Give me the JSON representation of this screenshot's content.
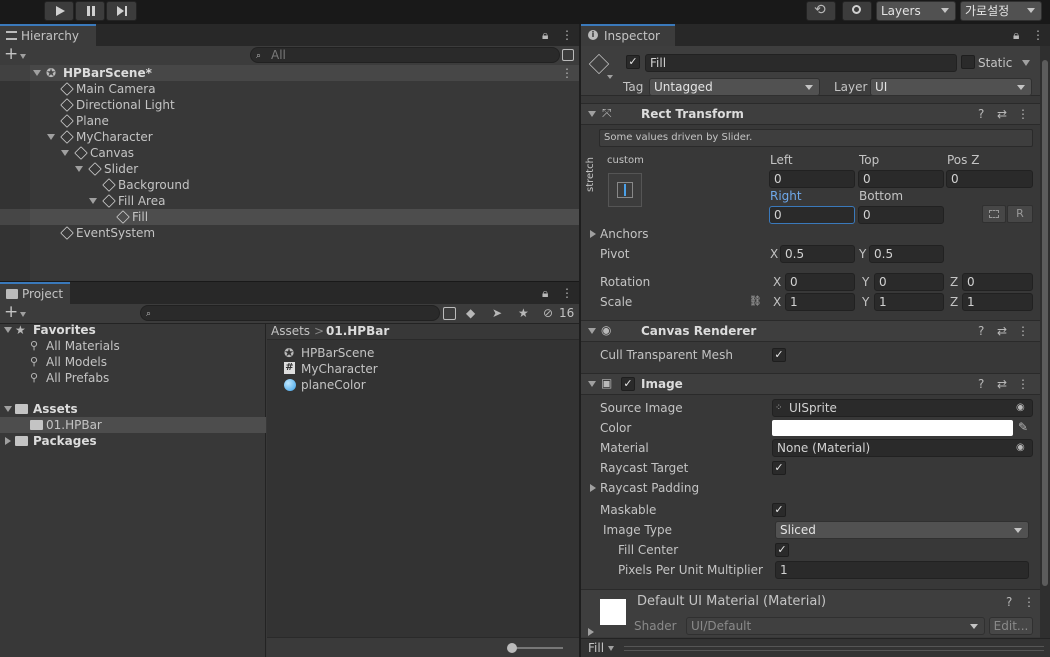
{
  "toolbar": {
    "layers": "Layers",
    "layout": "가로설정"
  },
  "hierarchy": {
    "tab": "Hierarchy",
    "search_placeholder": "All",
    "scene": "HPBarScene*",
    "items": [
      "Main Camera",
      "Directional Light",
      "Plane",
      "MyCharacter",
      "Canvas",
      "Slider",
      "Background",
      "Fill Area",
      "Fill",
      "EventSystem"
    ]
  },
  "project": {
    "tab": "Project",
    "hidden_count": "16",
    "favorites": {
      "label": "Favorites",
      "items": [
        "All Materials",
        "All Models",
        "All Prefabs"
      ]
    },
    "assets": "Assets",
    "assets_child": "01.HPBar",
    "packages": "Packages",
    "breadcrumb": [
      "Assets",
      "01.HPBar"
    ],
    "files": [
      "HPBarScene",
      "MyCharacter",
      "planeColor"
    ]
  },
  "inspector": {
    "tab": "Inspector",
    "object_name": "Fill",
    "static_label": "Static",
    "tag_label": "Tag",
    "tag_value": "Untagged",
    "layer_label": "Layer",
    "layer_value": "UI",
    "rect": {
      "title": "Rect Transform",
      "note": "Some values driven by Slider.",
      "anchor_preset": "custom",
      "stretch": "stretch",
      "left_label": "Left",
      "left": "0",
      "top_label": "Top",
      "top": "0",
      "posz_label": "Pos Z",
      "posz": "0",
      "right_label": "Right",
      "right": "0",
      "bottom_label": "Bottom",
      "bottom": "0",
      "r_button": "R",
      "anchors_label": "Anchors",
      "pivot_label": "Pivot",
      "pivot_x": "0.5",
      "pivot_y": "0.5",
      "rotation_label": "Rotation",
      "rot_x": "0",
      "rot_y": "0",
      "rot_z": "0",
      "scale_label": "Scale",
      "scale_x": "1",
      "scale_y": "1",
      "scale_z": "1",
      "x": "X",
      "y": "Y",
      "z": "Z"
    },
    "canvas_renderer": {
      "title": "Canvas Renderer",
      "cull_label": "Cull Transparent Mesh"
    },
    "image": {
      "title": "Image",
      "source_label": "Source Image",
      "source_value": "UISprite",
      "color_label": "Color",
      "color_value": "#ffffff",
      "material_label": "Material",
      "material_value": "None (Material)",
      "raycast_target_label": "Raycast Target",
      "raycast_padding_label": "Raycast Padding",
      "maskable_label": "Maskable",
      "image_type_label": "Image Type",
      "image_type_value": "Sliced",
      "fill_center_label": "Fill Center",
      "ppu_label": "Pixels Per Unit Multiplier",
      "ppu_value": "1"
    },
    "material": {
      "title": "Default UI Material (Material)",
      "shader_label": "Shader",
      "shader_value": "UI/Default",
      "edit_button": "Edit..."
    },
    "footer": "Fill"
  },
  "colors": {
    "accent": "#3a79bb",
    "panel": "#383838",
    "selection": "#4d4d4d"
  }
}
